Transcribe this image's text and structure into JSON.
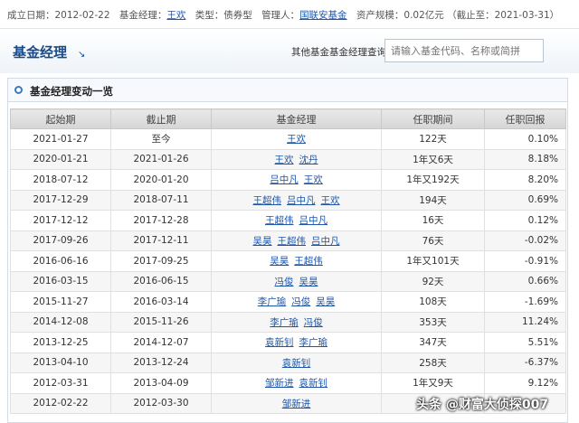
{
  "top_info": {
    "established_label": "成立日期：",
    "established_value": "2012-02-22",
    "manager_label": "基金经理：",
    "manager_value": "王欢",
    "type_label": "类型：",
    "type_value": "债券型",
    "admin_label": "管理人：",
    "admin_value": "国联安基金",
    "size_label": "资产规模：",
    "size_value": "0.02亿元 （截止至：2021-03-31）"
  },
  "header": {
    "title": "基金经理",
    "title_arrow": "↘",
    "search_label": "其他基金基金经理查询：",
    "search_placeholder": "请输入基金代码、名称或简拼"
  },
  "panel": {
    "title": "基金经理变动一览"
  },
  "table": {
    "columns": [
      "起始期",
      "截止期",
      "基金经理",
      "任职期间",
      "任职回报"
    ],
    "rows": [
      {
        "start": "2021-01-27",
        "end": "至今",
        "managers": [
          "王欢"
        ],
        "period": "122天",
        "return": "0.10%",
        "sign": "pos"
      },
      {
        "start": "2020-01-21",
        "end": "2021-01-26",
        "managers": [
          "王欢",
          "沈丹"
        ],
        "period": "1年又6天",
        "return": "8.18%",
        "sign": "pos"
      },
      {
        "start": "2018-07-12",
        "end": "2020-01-20",
        "managers": [
          "吕中凡",
          "王欢"
        ],
        "period": "1年又192天",
        "return": "8.20%",
        "sign": "pos"
      },
      {
        "start": "2017-12-29",
        "end": "2018-07-11",
        "managers": [
          "王超伟",
          "吕中凡",
          "王欢"
        ],
        "period": "194天",
        "return": "0.69%",
        "sign": "pos"
      },
      {
        "start": "2017-12-12",
        "end": "2017-12-28",
        "managers": [
          "王超伟",
          "吕中凡"
        ],
        "period": "16天",
        "return": "0.12%",
        "sign": "pos"
      },
      {
        "start": "2017-09-26",
        "end": "2017-12-11",
        "managers": [
          "吴昊",
          "王超伟",
          "吕中凡"
        ],
        "period": "76天",
        "return": "-0.02%",
        "sign": "neg"
      },
      {
        "start": "2016-06-16",
        "end": "2017-09-25",
        "managers": [
          "吴昊",
          "王超伟"
        ],
        "period": "1年又101天",
        "return": "-0.91%",
        "sign": "neg"
      },
      {
        "start": "2016-03-15",
        "end": "2016-06-15",
        "managers": [
          "冯俊",
          "吴昊"
        ],
        "period": "92天",
        "return": "0.66%",
        "sign": "pos"
      },
      {
        "start": "2015-11-27",
        "end": "2016-03-14",
        "managers": [
          "李广瑜",
          "冯俊",
          "吴昊"
        ],
        "period": "108天",
        "return": "-1.69%",
        "sign": "neg"
      },
      {
        "start": "2014-12-08",
        "end": "2015-11-26",
        "managers": [
          "李广瑜",
          "冯俊"
        ],
        "period": "353天",
        "return": "11.24%",
        "sign": "pos"
      },
      {
        "start": "2013-12-25",
        "end": "2014-12-07",
        "managers": [
          "袁新钊",
          "李广瑜"
        ],
        "period": "347天",
        "return": "5.51%",
        "sign": "pos"
      },
      {
        "start": "2013-04-10",
        "end": "2013-12-24",
        "managers": [
          "袁新钊"
        ],
        "period": "258天",
        "return": "-6.37%",
        "sign": "neg"
      },
      {
        "start": "2012-03-31",
        "end": "2013-04-09",
        "managers": [
          "邹新进",
          "袁新钊"
        ],
        "period": "1年又9天",
        "return": "9.12%",
        "sign": "pos"
      },
      {
        "start": "2012-02-22",
        "end": "2012-03-30",
        "managers": [
          "邹新进"
        ],
        "period": "",
        "return": "",
        "sign": "pos"
      }
    ]
  },
  "watermark": "头条 @财富大侦探007",
  "colors": {
    "positive": "#e21e1e",
    "negative": "#1a8a1a",
    "link": "#1f56a8",
    "title": "#1a4a86"
  }
}
